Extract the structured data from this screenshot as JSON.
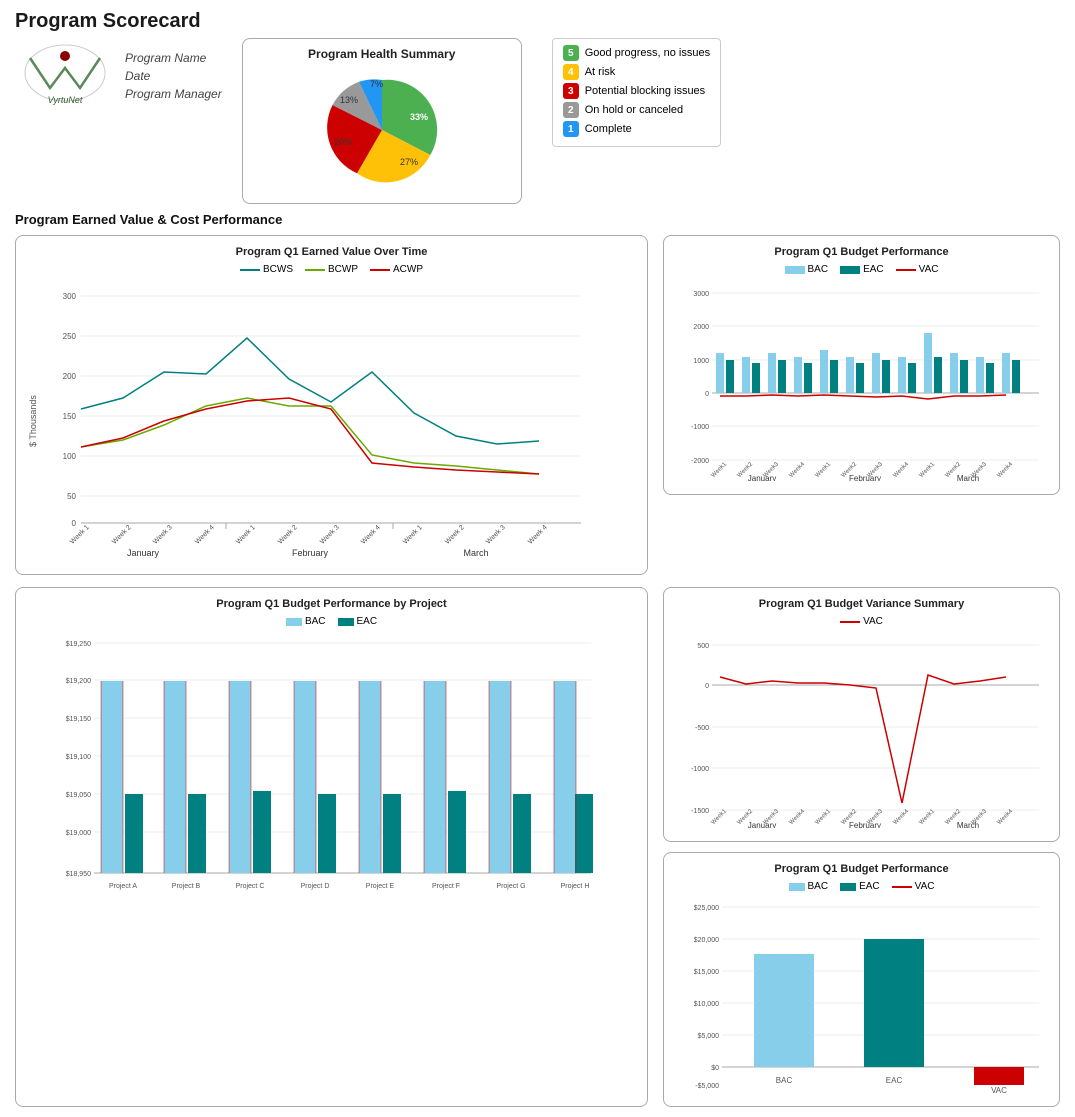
{
  "page": {
    "title": "Program Scorecard"
  },
  "header": {
    "program_name_label": "Program Name",
    "date_label": "Date",
    "manager_label": "Program Manager"
  },
  "health_summary": {
    "title": "Program Health Summary",
    "legend": [
      {
        "score": 5,
        "color": "#4CAF50",
        "label": "Good progress, no issues"
      },
      {
        "score": 4,
        "color": "#FFC107",
        "label": "At risk"
      },
      {
        "score": 3,
        "color": "#F44336",
        "label": "Potential blocking issues"
      },
      {
        "score": 2,
        "color": "#9E9E9E",
        "label": "On hold or canceled"
      },
      {
        "score": 1,
        "color": "#2196F3",
        "label": "Complete"
      }
    ],
    "slices": [
      {
        "pct": 33,
        "color": "#4CAF50",
        "label": "33%"
      },
      {
        "pct": 27,
        "color": "#FFC107",
        "label": "27%"
      },
      {
        "pct": 20,
        "color": "#F44336",
        "label": "20%"
      },
      {
        "pct": 13,
        "color": "#9E9E9E",
        "label": "13%"
      },
      {
        "pct": 7,
        "color": "#2196F3",
        "label": "7%"
      }
    ]
  },
  "earned_value_section": {
    "title": "Program Earned Value & Cost Performance"
  },
  "charts": {
    "ev_over_time": {
      "title": "Program Q1 Earned Value Over Time",
      "legend": [
        "BCWS",
        "BCWP",
        "ACWP"
      ],
      "legend_colors": [
        "#008080",
        "#6aaa00",
        "#cc0000"
      ],
      "y_label": "$ Thousands",
      "months": [
        "January",
        "February",
        "March"
      ]
    },
    "budget_perf": {
      "title": "Program Q1 Budget Performance",
      "legend": [
        "BAC",
        "EAC",
        "VAC"
      ],
      "legend_colors": [
        "#87CEEB",
        "#008080",
        "#cc0000"
      ]
    },
    "budget_variance": {
      "title": "Program Q1 Budget Variance Summary",
      "legend": [
        "VAC"
      ],
      "legend_colors": [
        "#cc0000"
      ]
    },
    "budget_perf_total": {
      "title": "Program Q1 Budget Performance",
      "legend": [
        "BAC",
        "EAC",
        "VAC"
      ],
      "legend_colors": [
        "#87CEEB",
        "#008080",
        "#cc0000"
      ]
    },
    "budget_by_project": {
      "title": "Program Q1 Budget Performance by Project",
      "legend": [
        "BAC",
        "EAC"
      ],
      "legend_colors": [
        "#87CEEB",
        "#008080"
      ],
      "projects": [
        "Project A",
        "Project B",
        "Project C",
        "Project D",
        "Project E",
        "Project F",
        "Project G",
        "Project H"
      ],
      "y_labels": [
        "$18,950",
        "$19,000",
        "$19,050",
        "$19,100",
        "$19,150",
        "$19,200",
        "$19,250"
      ]
    }
  }
}
